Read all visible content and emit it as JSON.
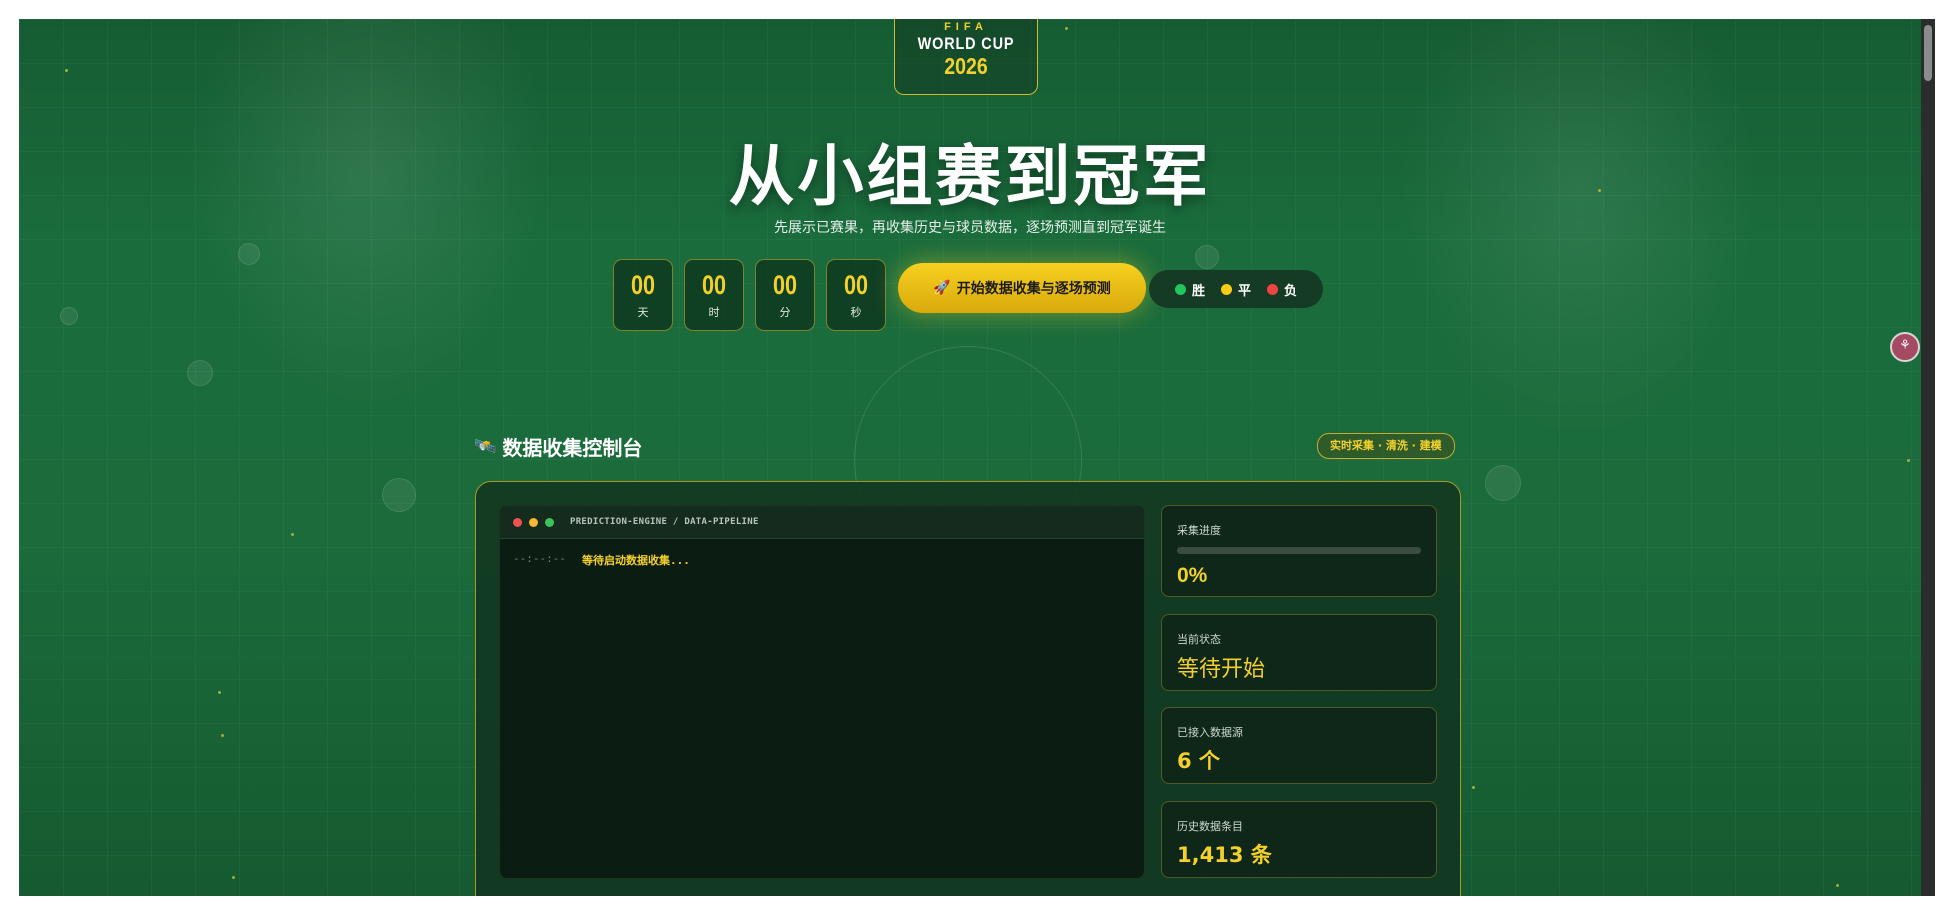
{
  "logo": {
    "line1": "FIFA",
    "line2": "WORLD CUP",
    "line3": "2026"
  },
  "hero": {
    "title": "从小组赛到冠军",
    "subtitle": "先展示已赛果，再收集历史与球员数据，逐场预测直到冠军诞生"
  },
  "countdown": [
    {
      "value": "00",
      "unit": "天"
    },
    {
      "value": "00",
      "unit": "时"
    },
    {
      "value": "00",
      "unit": "分"
    },
    {
      "value": "00",
      "unit": "秒"
    }
  ],
  "start_button": {
    "icon": "rocket-icon",
    "glyph": "🚀",
    "label": "开始数据收集与逐场预测"
  },
  "legend": [
    {
      "label": "胜",
      "color": "#22c55e"
    },
    {
      "label": "平",
      "color": "#facc15"
    },
    {
      "label": "负",
      "color": "#ef4444"
    }
  ],
  "section": {
    "icon": "satellite-icon",
    "glyph": "🛰️",
    "title": "数据收集控制台",
    "badge": "实时采集 · 清洗 · 建模"
  },
  "terminal": {
    "title": "PREDICTION-ENGINE / DATA-PIPELINE",
    "lines": [
      {
        "time": "--:--:--",
        "message": "等待启动数据收集..."
      }
    ]
  },
  "stats": {
    "progress": {
      "label": "采集进度",
      "value": "0%",
      "fraction": 0
    },
    "status": {
      "label": "当前状态",
      "value": "等待开始"
    },
    "sources": {
      "label": "已接入数据源",
      "value": "6 个"
    },
    "records": {
      "label": "历史数据条目",
      "value": "1,413 条"
    }
  },
  "colors": {
    "accent": "#f4d02c",
    "field_green": "#1a6c3c"
  }
}
